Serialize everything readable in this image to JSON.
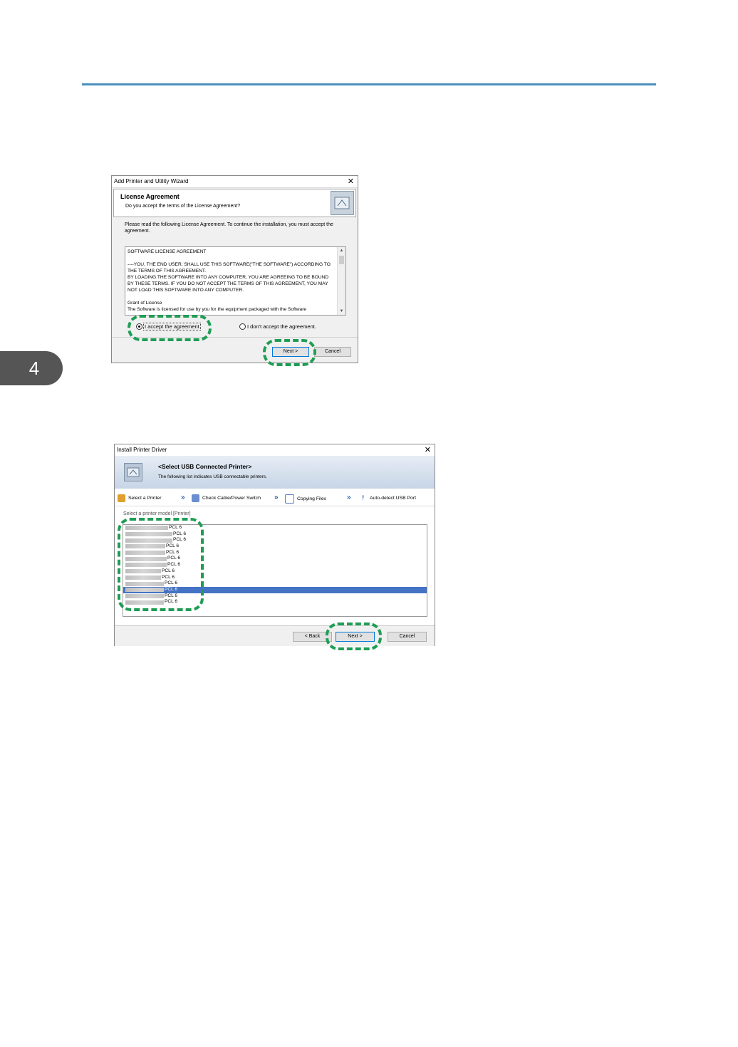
{
  "chapter": {
    "number": "4"
  },
  "wizard": {
    "window_title": "Add Printer and Utility Wizard",
    "close_label": "✕",
    "header_title": "License Agreement",
    "header_subtitle": "Do you accept the terms of the License Agreement?",
    "intro_text": "Please read the following License Agreement. To continue the installation, you must accept the agreement.",
    "license_text": "SOFTWARE LICENSE AGREEMENT\n\n----YOU, THE END USER, SHALL USE THIS SOFTWARE(\"THE SOFTWARE\") ACCORDING TO THE TERMS OF THIS AGREEMENT.\nBY LOADING THE SOFTWARE INTO ANY COMPUTER, YOU ARE AGREEING TO BE BOUND BY THESE TERMS. IF YOU DO NOT ACCEPT THE TERMS OF THIS AGREEMENT, YOU MAY NOT LOAD THIS SOFTWARE INTO ANY COMPUTER.\n\nGrant of License\nThe Software is licensed for use by you for the equipment packaged with the Software",
    "accept_label": "I accept the agreement",
    "decline_label": "I don't accept the agreement.",
    "accept_selected": true,
    "next_label": "Next >",
    "cancel_label": "Cancel"
  },
  "install": {
    "window_title": "Install Printer Driver",
    "close_label": "✕",
    "banner_title": "<Select USB Connected Printer>",
    "banner_subtitle": "The following list indicates USB connectable printers.",
    "steps": [
      {
        "label": "Select a Printer",
        "icon": "printer-icon"
      },
      {
        "label": "Check Cable/Power Switch",
        "icon": "plug-icon"
      },
      {
        "label": "Copying Files",
        "icon": "copy-icon"
      },
      {
        "label": "Auto-detect USB Port",
        "icon": "usb-icon"
      }
    ],
    "list_label": "Select a printer model [Printer]",
    "printers": [
      {
        "suffix": "PCL 6"
      },
      {
        "suffix": "PCL 6"
      },
      {
        "suffix": "PCL 6"
      },
      {
        "suffix": "PCL 6"
      },
      {
        "suffix": "PCL 6"
      },
      {
        "suffix": "PCL 6"
      },
      {
        "suffix": "PCL 6"
      },
      {
        "suffix": "PCL 6"
      },
      {
        "suffix": "PCL 6"
      },
      {
        "suffix": "PCL 6"
      },
      {
        "suffix": "PCL 6"
      },
      {
        "suffix": "PCL 6"
      },
      {
        "suffix": "PCL 6"
      }
    ],
    "selected_printer_index": 10,
    "back_label": "< Back",
    "next_label": "Next >",
    "cancel_label": "Cancel"
  },
  "colors": {
    "accent_rule": "#4a90c0",
    "highlight": "#1f9d55",
    "selection": "#4472c4"
  }
}
